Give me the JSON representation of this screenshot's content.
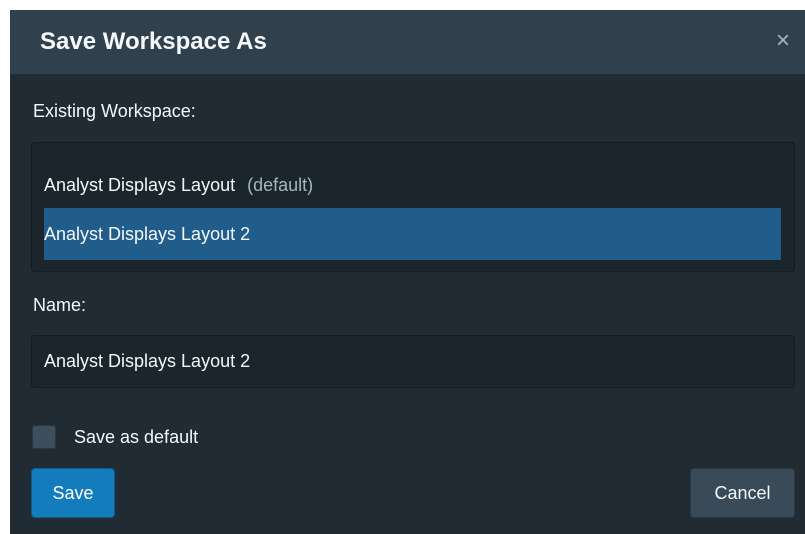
{
  "dialog": {
    "title": "Save Workspace As",
    "close_glyph": "×"
  },
  "existing": {
    "label": "Existing Workspace:",
    "items": [
      {
        "name": "Analyst Displays Layout",
        "suffix": "(default)",
        "selected": false
      },
      {
        "name": "Analyst Displays Layout 2",
        "suffix": "",
        "selected": true
      }
    ]
  },
  "name_field": {
    "label": "Name:",
    "value": "Analyst Displays Layout 2",
    "placeholder": ""
  },
  "default_checkbox": {
    "label": "Save as default",
    "checked": false
  },
  "buttons": {
    "save_label": "Save",
    "cancel_label": "Cancel"
  },
  "colors": {
    "dialog_bg": "#202b33",
    "header_bg": "#30404d",
    "selected_bg": "#215d8b",
    "primary": "#137cbd"
  },
  "icons": {
    "close": "close-icon",
    "checkbox": "checkbox-icon"
  }
}
